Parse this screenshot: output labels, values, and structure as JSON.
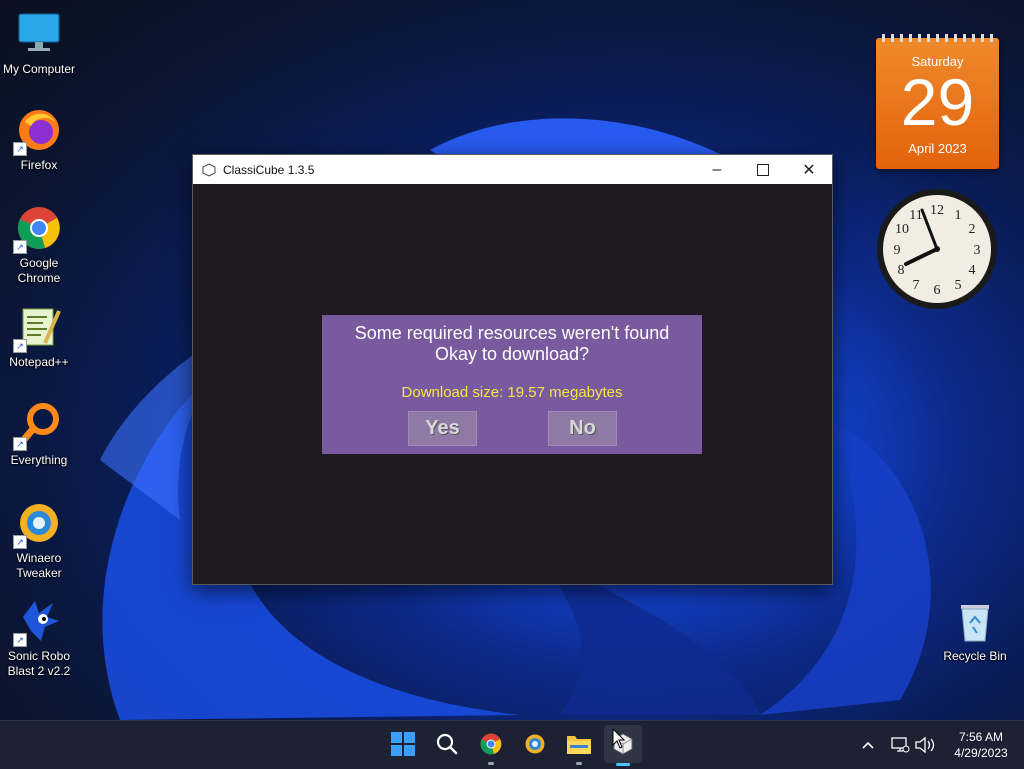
{
  "desktop": {
    "icons": [
      {
        "label": "My Computer"
      },
      {
        "label": "Firefox"
      },
      {
        "label": "Google Chrome"
      },
      {
        "label": "Notepad++"
      },
      {
        "label": "Everything"
      },
      {
        "label": "Winaero Tweaker"
      },
      {
        "label": "Sonic Robo Blast 2 v2.2"
      },
      {
        "label": "Recycle Bin"
      }
    ]
  },
  "calendar": {
    "weekday": "Saturday",
    "day": "29",
    "month_year": "April 2023"
  },
  "window": {
    "title": "ClassiCube 1.3.5",
    "dialog": {
      "line1": "Some required resources weren't found",
      "line2": "Okay to download?",
      "size": "Download size: 19.57 megabytes",
      "yes": "Yes",
      "no": "No"
    }
  },
  "taskbar": {
    "time": "7:56 AM",
    "date": "4/29/2023"
  },
  "colors": {
    "dialog_bg": "#7a5a9e",
    "size_text": "#f5e642",
    "calendar": "#e8701a",
    "window_bg": "#1f1a22"
  }
}
